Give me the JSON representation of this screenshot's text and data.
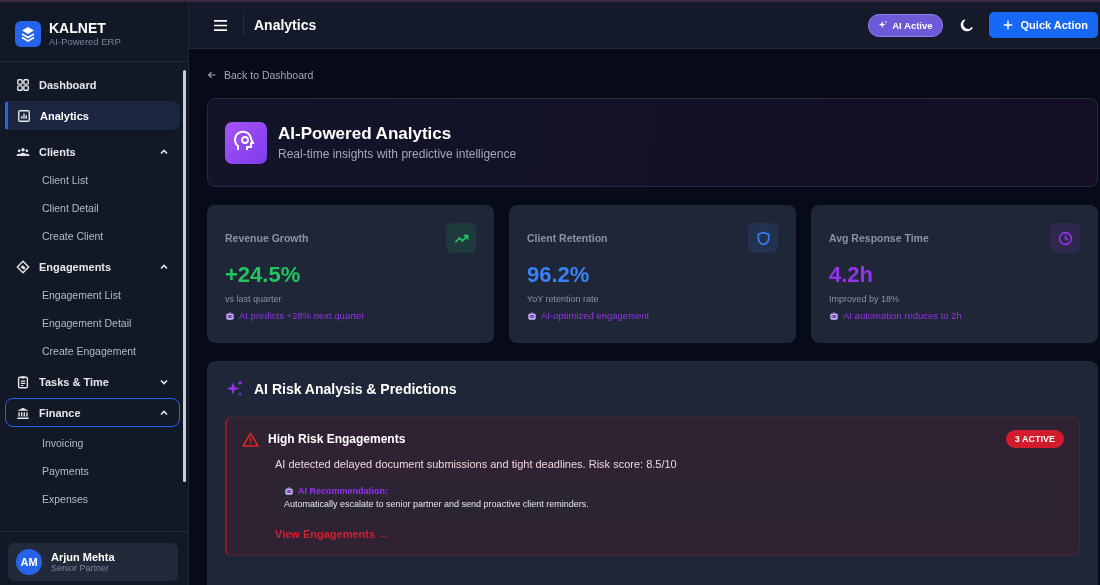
{
  "brand": {
    "name": "KALNET",
    "tagline": "AI-Powered ERP"
  },
  "nav": [
    {
      "kind": "item",
      "label": "Dashboard",
      "selected": false
    },
    {
      "kind": "item",
      "label": "Analytics",
      "selected": true
    },
    {
      "kind": "group",
      "label": "Clients",
      "expanded": true,
      "focused": false,
      "children": [
        {
          "label": "Client List"
        },
        {
          "label": "Client Detail"
        },
        {
          "label": "Create Client"
        }
      ]
    },
    {
      "kind": "group",
      "label": "Engagements",
      "expanded": true,
      "focused": false,
      "children": [
        {
          "label": "Engagement List"
        },
        {
          "label": "Engagement Detail"
        },
        {
          "label": "Create Engagement"
        }
      ]
    },
    {
      "kind": "group",
      "label": "Tasks & Time",
      "expanded": false,
      "focused": false
    },
    {
      "kind": "group",
      "label": "Finance",
      "expanded": true,
      "focused": true,
      "children": [
        {
          "label": "Invoicing"
        },
        {
          "label": "Payments"
        },
        {
          "label": "Expenses"
        }
      ]
    }
  ],
  "user": {
    "initials": "AM",
    "name": "Arjun Mehta",
    "role": "Senior Partner"
  },
  "header": {
    "title": "Analytics",
    "ai_badge": "AI Active",
    "quick_action": "Quick Action"
  },
  "back_link": "Back to Dashboard",
  "hero": {
    "title": "AI-Powered Analytics",
    "subtitle": "Real-time insights with predictive intelligence"
  },
  "stats": [
    {
      "kind": "trend",
      "label": "Revenue Growth",
      "value": "+24.5%",
      "note": "vs last quarter",
      "ai_note": "AI predicts +28% next quarter",
      "color": "#22c55e"
    },
    {
      "kind": "shield",
      "label": "Client Retention",
      "value": "96.2%",
      "note": "YoY retention rate",
      "ai_note": "AI-optimized engagement",
      "color": "#3b82f6"
    },
    {
      "kind": "clock",
      "label": "Avg Response Time",
      "value": "4.2h",
      "note": "Improved by 18%",
      "ai_note": "AI automation reduces to 2h",
      "color": "#9333ea"
    }
  ],
  "risk": {
    "title": "AI Risk Analysis & Predictions",
    "alert": {
      "title": "High Risk Engagements",
      "badge": "3 ACTIVE",
      "text": "AI detected delayed document submissions and tight deadlines. Risk score: 8.5/10",
      "rec_label": "AI Recommendation:",
      "rec_text": "Automatically escalate to senior partner and send proactive client reminders.",
      "link": "View Engagements →"
    }
  }
}
